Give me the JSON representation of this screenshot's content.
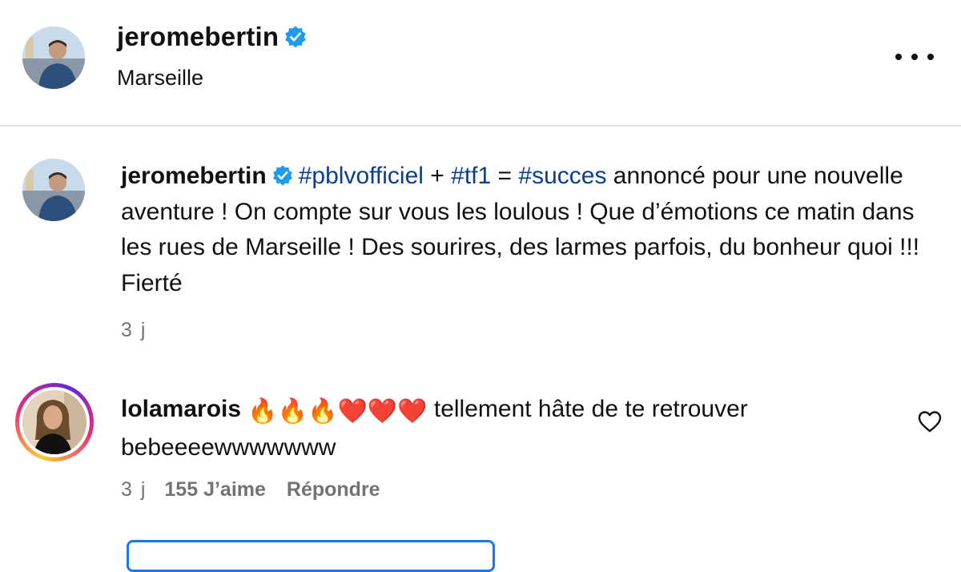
{
  "header": {
    "username": "jeromebertin",
    "location": "Marseille",
    "verified_icon": "verified-badge-icon",
    "more_icon": "more-horizontal-icon"
  },
  "caption": {
    "username": "jeromebertin",
    "hashtag1": "#pblvofficiel",
    "plus": " + ",
    "hashtag2": "#tf1",
    "equals": " = ",
    "hashtag3": "#succes",
    "text": " annoncé pour une nouvelle aventure ! On compte sur vous les loulous ! Que d’émotions ce matin dans les rues de Marseille ! Des sourires, des larmes parfois, du bonheur quoi !!! Fierté",
    "time": "3 j"
  },
  "comment": {
    "username": "lolamarois",
    "emojis": "🔥🔥🔥❤️❤️❤️",
    "text": " tellement hâte de te retrouver bebeeeewwwwwww",
    "time": "3 j",
    "likes": "155 J’aime",
    "reply": "Répondre",
    "like_icon": "heart-outline-icon"
  },
  "colors": {
    "hashtag": "#0b3d91",
    "verified": "#1d9bf0",
    "meta_text": "#737373",
    "divider": "#e3e3e3",
    "focus_border": "#1877f2"
  }
}
